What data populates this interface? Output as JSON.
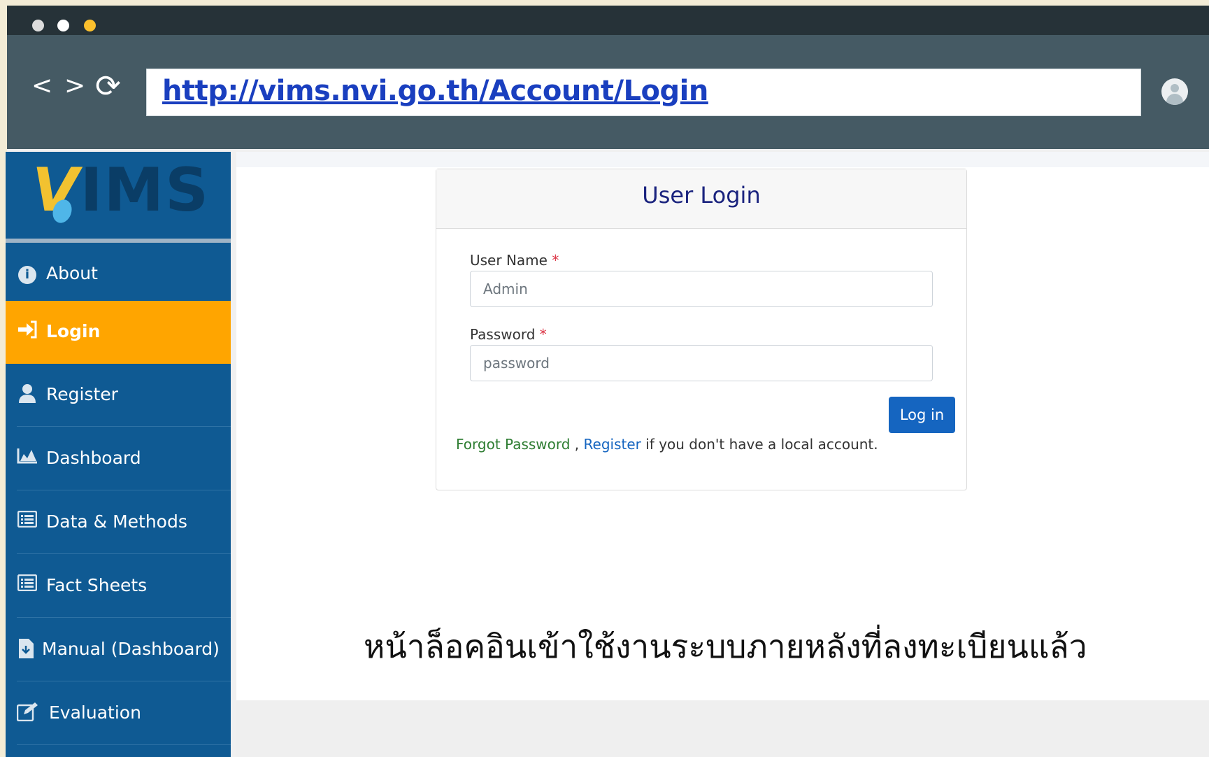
{
  "browser": {
    "url": "http://vims.nvi.go.th/Account/Login",
    "back_icon": "<",
    "forward_icon": ">",
    "reload_icon": "⟳"
  },
  "sidebar": {
    "logo_text_v": "V",
    "logo_text_rest": "IMS",
    "items": [
      {
        "label": "About",
        "icon": "info-icon",
        "glyph": "i"
      },
      {
        "label": "Login",
        "icon": "sign-in-icon",
        "glyph": "➜]",
        "active": true
      },
      {
        "label": "Register",
        "icon": "user-icon",
        "glyph": "👤"
      },
      {
        "label": "Dashboard",
        "icon": "area-chart-icon",
        "glyph": "▙"
      },
      {
        "label": "Data & Methods",
        "icon": "list-icon",
        "glyph": "☰"
      },
      {
        "label": "Fact Sheets",
        "icon": "list-icon",
        "glyph": "☰"
      },
      {
        "label": "Manual (Dashboard)",
        "icon": "file-download-icon",
        "glyph": "⇩"
      },
      {
        "label": "Evaluation",
        "icon": "edit-icon",
        "glyph": "✎"
      }
    ]
  },
  "login": {
    "title": "User Login",
    "username_label": "User Name",
    "username_value": "Admin",
    "password_label": "Password",
    "password_value": "password",
    "required_mark": "*",
    "button_label": "Log in",
    "forgot_link": "Forgot Password",
    "separator": " , ",
    "register_link": "Register",
    "help_suffix": " if you don't have a local account."
  },
  "caption": "หน้าล็อคอินเข้าใช้งานระบบภายหลังที่ลงทะเบียนแล้ว"
}
